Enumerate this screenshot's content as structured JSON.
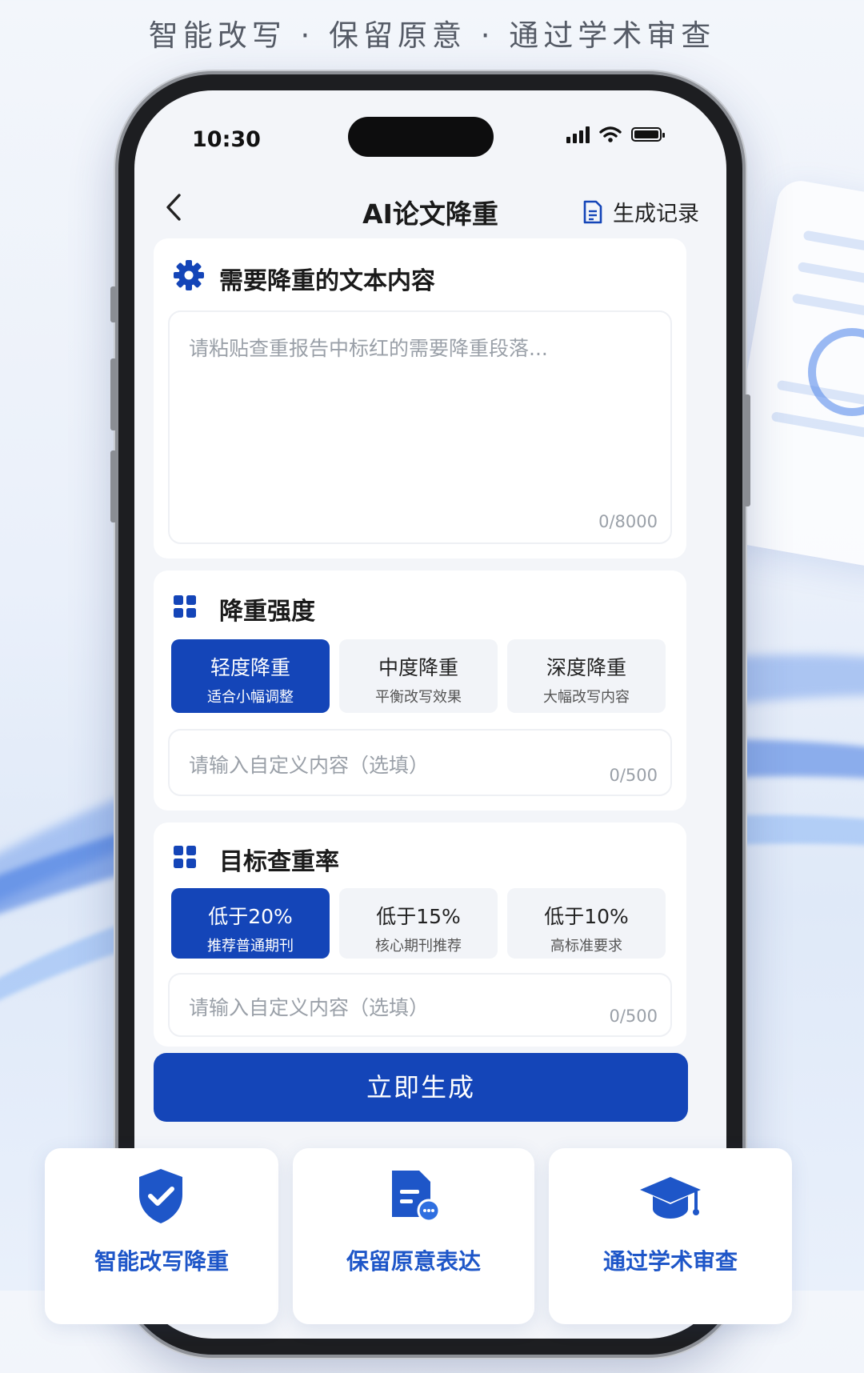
{
  "banner": "智能改写 · 保留原意 · 通过学术审查",
  "status_bar": {
    "time": "10:30"
  },
  "nav": {
    "back_icon": "‹",
    "title": "AI论文降重",
    "history_label": "生成记录"
  },
  "text_section": {
    "title": "需要降重的文本内容",
    "placeholder": "请粘贴查重报告中标红的需要降重段落...",
    "counter": "0/8000"
  },
  "intensity_section": {
    "title": "降重强度",
    "options": [
      {
        "label": "轻度降重",
        "desc": "适合小幅调整",
        "selected": true
      },
      {
        "label": "中度降重",
        "desc": "平衡改写效果",
        "selected": false
      },
      {
        "label": "深度降重",
        "desc": "大幅改写内容",
        "selected": false
      }
    ],
    "custom_placeholder": "请输入自定义内容（选填）",
    "custom_counter": "0/500"
  },
  "target_section": {
    "title": "目标查重率",
    "options": [
      {
        "label": "低于20%",
        "desc": "推荐普通期刊",
        "selected": true
      },
      {
        "label": "低于15%",
        "desc": "核心期刊推荐",
        "selected": false
      },
      {
        "label": "低于10%",
        "desc": "高标准要求",
        "selected": false
      }
    ],
    "custom_placeholder": "请输入自定义内容（选填）",
    "custom_counter": "0/500"
  },
  "generate_button": "立即生成",
  "features": [
    {
      "label": "智能改写降重",
      "icon": "shield-check-icon"
    },
    {
      "label": "保留原意表达",
      "icon": "document-chat-icon"
    },
    {
      "label": "通过学术审查",
      "icon": "graduation-cap-icon"
    }
  ],
  "colors": {
    "primary": "#1445b8",
    "accent": "#1e56c8",
    "text": "#1a1a1a",
    "muted": "#9aa0a8"
  }
}
